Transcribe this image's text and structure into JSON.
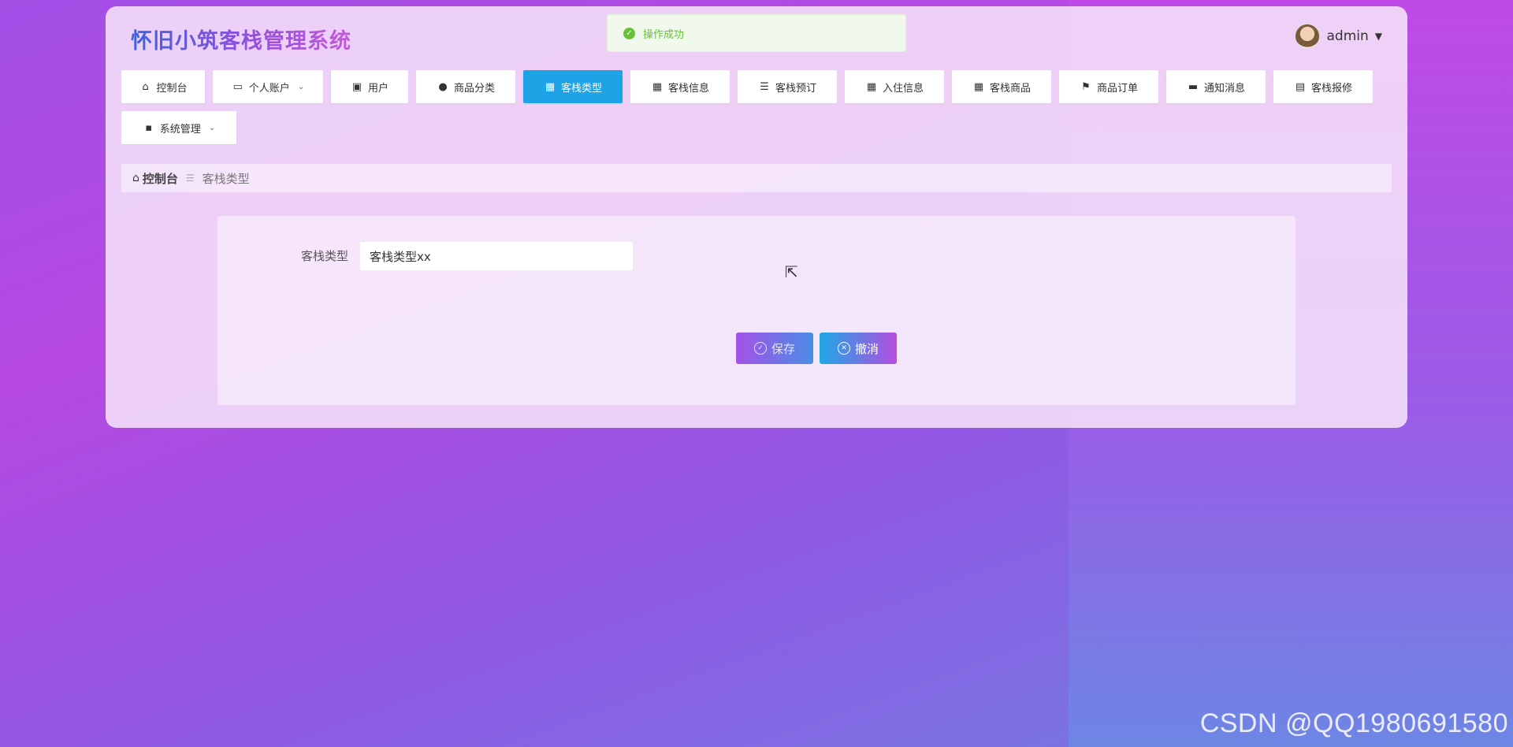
{
  "header": {
    "app_title": "怀旧小筑客栈管理系统",
    "username": "admin"
  },
  "toast": {
    "message": "操作成功",
    "status_color": "#67c23a"
  },
  "nav": {
    "items": [
      {
        "label": "控制台",
        "icon": "home-icon"
      },
      {
        "label": "个人账户",
        "icon": "wallet-icon",
        "dropdown": true
      },
      {
        "label": "用户",
        "icon": "clipboard-check-icon"
      },
      {
        "label": "商品分类",
        "icon": "balloon-icon"
      },
      {
        "label": "客栈类型",
        "icon": "grid-icon",
        "active": true
      },
      {
        "label": "客栈信息",
        "icon": "grid-icon"
      },
      {
        "label": "客栈预订",
        "icon": "list-icon"
      },
      {
        "label": "入住信息",
        "icon": "grid-icon"
      },
      {
        "label": "客栈商品",
        "icon": "grid-icon"
      },
      {
        "label": "商品订单",
        "icon": "flag-icon"
      },
      {
        "label": "通知消息",
        "icon": "monitor-icon"
      },
      {
        "label": "客栈报修",
        "icon": "clipboard-icon"
      },
      {
        "label": "系统管理",
        "icon": "message-icon",
        "dropdown": true
      }
    ],
    "active_color": "#1ea3e6"
  },
  "breadcrumb": {
    "root": "控制台",
    "current": "客栈类型"
  },
  "form": {
    "field_label": "客栈类型",
    "field_value": "客栈类型xx",
    "save_label": "保存",
    "cancel_label": "撤消"
  },
  "watermark": "CSDN @QQ1980691580"
}
